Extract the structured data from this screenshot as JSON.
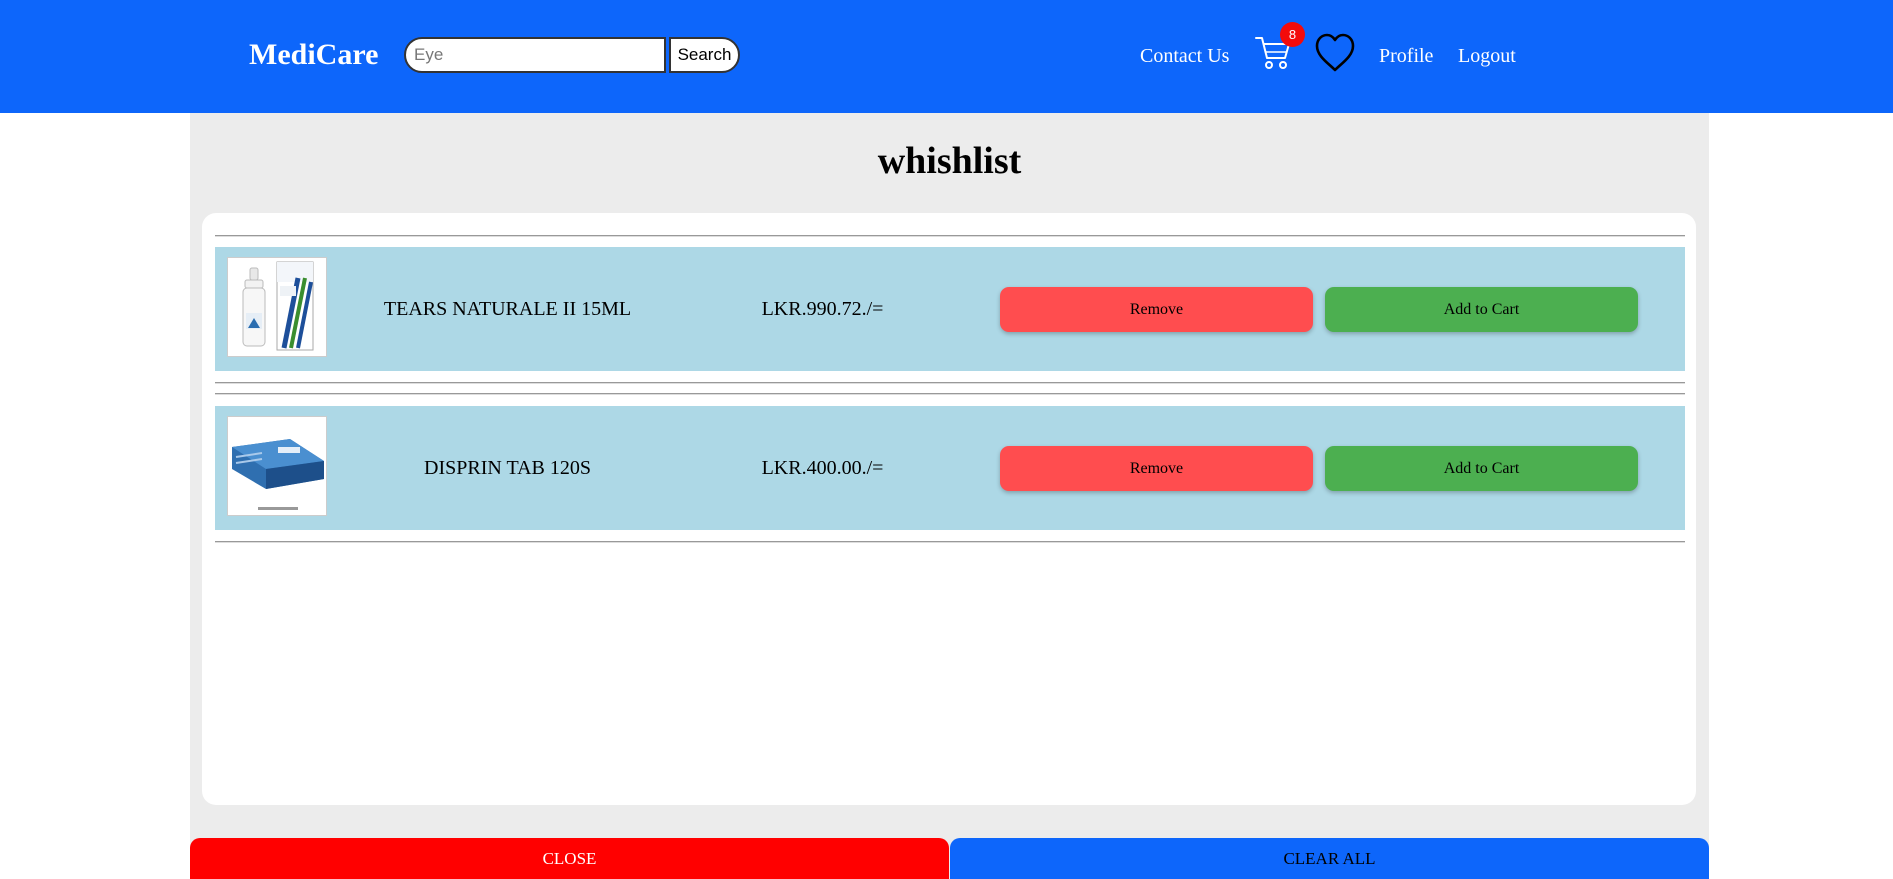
{
  "header": {
    "brand": "MediCare",
    "search": {
      "value": "",
      "placeholder": "Eye",
      "button_label": "Search"
    },
    "nav": {
      "contact_label": "Contact Us",
      "cart_count": "8",
      "profile_label": "Profile",
      "logout_label": "Logout"
    }
  },
  "page": {
    "title": "whishlist"
  },
  "wishlist": {
    "items": [
      {
        "name": "TEARS NATURALE II 15ML",
        "price": "LKR.990.72./=",
        "remove_label": "Remove",
        "add_label": "Add to Cart"
      },
      {
        "name": "DISPRIN TAB 120S",
        "price": "LKR.400.00./=",
        "remove_label": "Remove",
        "add_label": "Add to Cart"
      }
    ]
  },
  "footer": {
    "close_label": "CLOSE",
    "clear_label": "CLEAR ALL"
  },
  "colors": {
    "header_bg": "#0d66fb",
    "panel_bg": "#ececec",
    "row_bg": "#add8e6",
    "remove_bg": "#ff4d4f",
    "add_bg": "#4caf50",
    "close_bg": "#ff0000",
    "clear_bg": "#0d66fb",
    "badge_bg": "#f40b0b"
  }
}
